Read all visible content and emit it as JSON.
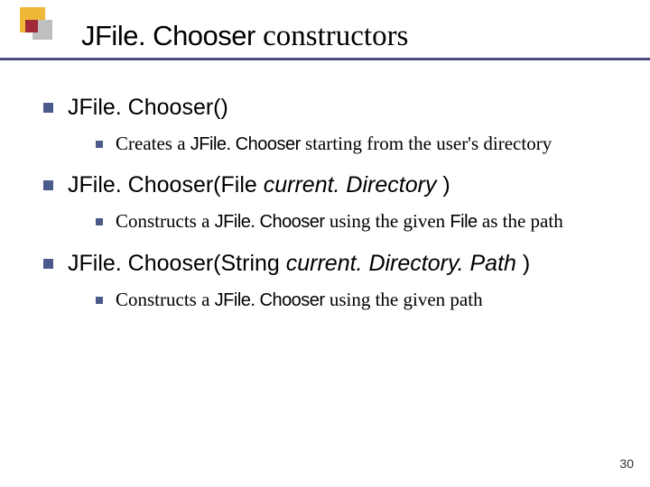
{
  "slide": {
    "title_sans": "JFile. Chooser",
    "title_serif": " constructors",
    "items": [
      {
        "heading_pre": "JFile. Chooser(",
        "heading_arg": "",
        "heading_post": ")",
        "sub_pre": "Creates a ",
        "sub_code": "JFile. Chooser",
        "sub_post": " starting from the user's directory"
      },
      {
        "heading_pre": "JFile. Chooser(File ",
        "heading_arg": "current. Directory",
        "heading_post": " )",
        "sub_pre": "Constructs a ",
        "sub_code": "JFile. Chooser",
        "sub_mid": " using the given ",
        "sub_code2": "File",
        "sub_post": "  as the path"
      },
      {
        "heading_pre": "JFile. Chooser(String ",
        "heading_arg": "current. Directory. Path",
        "heading_post": " )",
        "sub_pre": "Constructs a ",
        "sub_code": "JFile. Chooser",
        "sub_post": " using the given path"
      }
    ],
    "page_number": "30"
  }
}
